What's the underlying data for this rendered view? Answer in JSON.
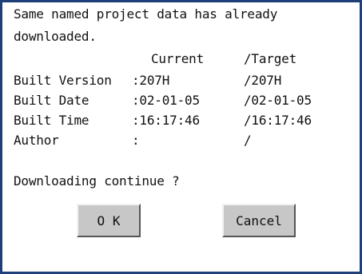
{
  "message": {
    "line1": "Same named project data has already",
    "line2": "downloaded."
  },
  "headers": {
    "current": "Current",
    "target": "/Target"
  },
  "rows": [
    {
      "label": "Built Version",
      "current": ":207H",
      "target": "/207H"
    },
    {
      "label": "Built Date",
      "current": ":02-01-05",
      "target": "/02-01-05"
    },
    {
      "label": "Built Time",
      "current": ":16:17:46",
      "target": "/16:17:46"
    },
    {
      "label": "Author",
      "current": ":",
      "target": "/"
    }
  ],
  "question": "Downloading continue ?",
  "buttons": {
    "ok_label": "O K",
    "cancel_label": "Cancel"
  }
}
